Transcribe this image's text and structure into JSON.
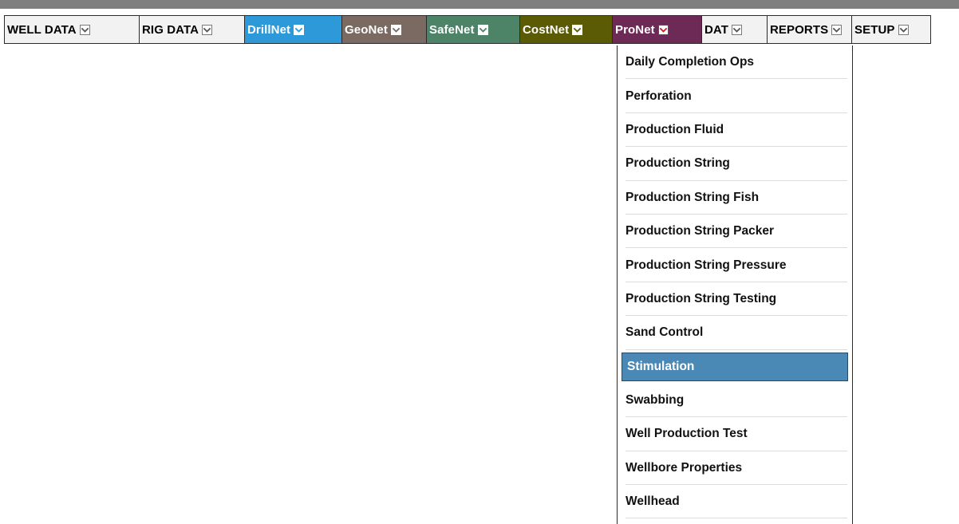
{
  "menubar": {
    "items": [
      {
        "label": "WELL DATA",
        "bg": "#f2f2f2",
        "fg": "#000000",
        "chev_style": "plain"
      },
      {
        "label": "RIG DATA",
        "bg": "#f2f2f2",
        "fg": "#000000",
        "chev_style": "plain"
      },
      {
        "label": "DrillNet",
        "bg": "#2e99d9",
        "fg": "#ffffff",
        "chev_style": "light"
      },
      {
        "label": "GeoNet",
        "bg": "#7b6a62",
        "fg": "#ffffff",
        "chev_style": "light"
      },
      {
        "label": "SafeNet",
        "bg": "#4d8367",
        "fg": "#ffffff",
        "chev_style": "light"
      },
      {
        "label": "CostNet",
        "bg": "#5b5a05",
        "fg": "#ffffff",
        "chev_style": "light"
      },
      {
        "label": "ProNet",
        "bg": "#6e2a57",
        "fg": "#ffffff",
        "chev_style": "red"
      },
      {
        "label": "DAT",
        "bg": "#f2f2f2",
        "fg": "#000000",
        "chev_style": "plain"
      },
      {
        "label": "REPORTS",
        "bg": "#f2f2f2",
        "fg": "#000000",
        "chev_style": "plain"
      },
      {
        "label": "SETUP",
        "bg": "#f2f2f2",
        "fg": "#000000",
        "chev_style": "plain"
      }
    ]
  },
  "dropdown": {
    "selected_bg": "#4a88b5",
    "selected_border": "#24496a",
    "items": [
      {
        "label": "Daily Completion Ops",
        "selected": false
      },
      {
        "label": "Perforation",
        "selected": false
      },
      {
        "label": "Production Fluid",
        "selected": false
      },
      {
        "label": "Production String",
        "selected": false
      },
      {
        "label": "Production String Fish",
        "selected": false
      },
      {
        "label": "Production String Packer",
        "selected": false
      },
      {
        "label": "Production String Pressure",
        "selected": false
      },
      {
        "label": "Production String Testing",
        "selected": false
      },
      {
        "label": "Sand Control",
        "selected": false
      },
      {
        "label": "Stimulation",
        "selected": true
      },
      {
        "label": "Swabbing",
        "selected": false
      },
      {
        "label": "Well Production Test",
        "selected": false
      },
      {
        "label": "Wellbore Properties",
        "selected": false
      },
      {
        "label": "Wellhead",
        "selected": false
      }
    ]
  }
}
